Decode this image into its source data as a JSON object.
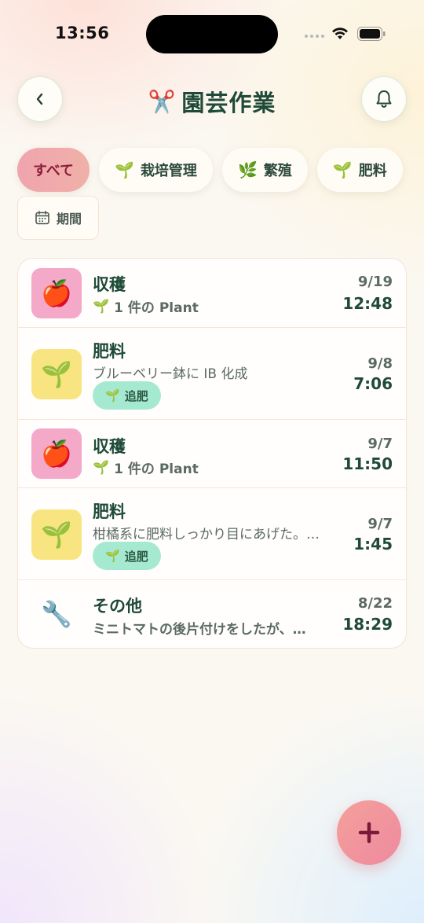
{
  "status": {
    "time": "13:56"
  },
  "header": {
    "title_icon": "✂️",
    "title": "園芸作業",
    "back_icon": "chevron-left-icon",
    "bell_icon": "bell-icon"
  },
  "filters": {
    "chips": [
      {
        "label": "すべて",
        "emoji": "",
        "active": true
      },
      {
        "label": "栽培管理",
        "emoji": "🌱",
        "active": false
      },
      {
        "label": "繁殖",
        "emoji": "🌿",
        "active": false
      },
      {
        "label": "肥料",
        "emoji": "🌱",
        "active": false
      }
    ],
    "period_label": "期間"
  },
  "entries": [
    {
      "title": "収穫",
      "subtitle": "1 件の Plant",
      "sub_emoji": "🌱",
      "icon": "🍎",
      "icon_bg": "pink",
      "date": "9/19",
      "time": "12:48",
      "tag": ""
    },
    {
      "title": "肥料",
      "subtitle": "ブルーベリー鉢に IB 化成",
      "sub_emoji": "",
      "icon": "🌱",
      "icon_bg": "yellow",
      "date": "9/8",
      "time": "7:06",
      "tag": "追肥",
      "tag_emoji": "🌱"
    },
    {
      "title": "収穫",
      "subtitle": "1 件の Plant",
      "sub_emoji": "🌱",
      "icon": "🍎",
      "icon_bg": "pink",
      "date": "9/7",
      "time": "11:50",
      "tag": ""
    },
    {
      "title": "肥料",
      "subtitle": "柑橘系に肥料しっかり目にあげた。…",
      "sub_emoji": "",
      "icon": "🌱",
      "icon_bg": "yellow",
      "date": "9/7",
      "time": "1:45",
      "tag": "追肥",
      "tag_emoji": "🌱"
    },
    {
      "title": "その他",
      "subtitle": "ミニトマトの後片付けをしたが、…",
      "sub_emoji": "",
      "icon": "🔧",
      "icon_bg": "plain",
      "date": "8/22",
      "time": "18:29",
      "tag": ""
    }
  ],
  "fab": {
    "label": "+",
    "icon": "plus-icon"
  },
  "colors": {
    "accent": "#f0a4ae",
    "text": "#1f4a38",
    "tag": "#a5ead0"
  }
}
